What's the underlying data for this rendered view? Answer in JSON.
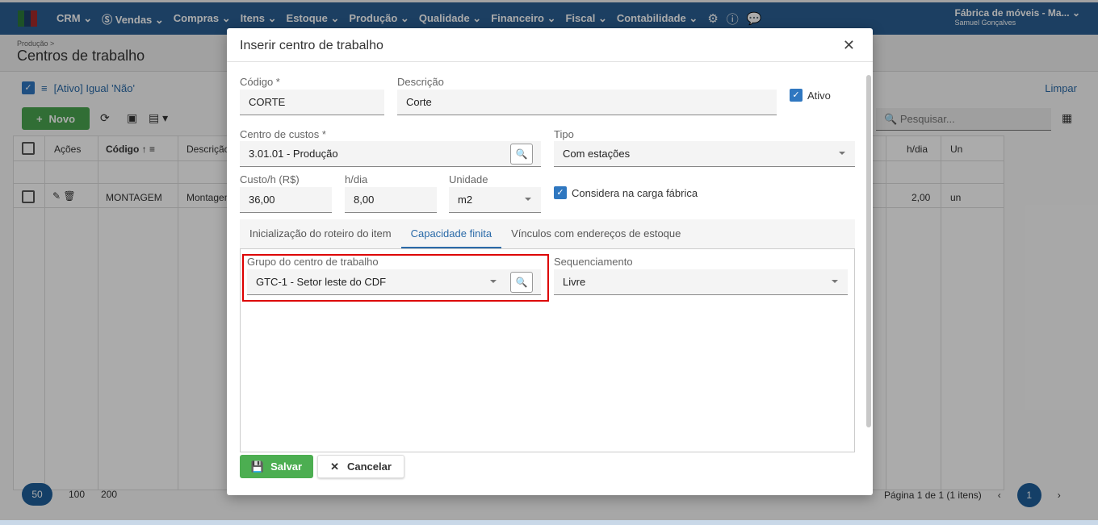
{
  "nav": {
    "items": [
      "CRM",
      "Vendas",
      "Compras",
      "Itens",
      "Estoque",
      "Produção",
      "Qualidade",
      "Financeiro",
      "Fiscal",
      "Contabilidade"
    ],
    "company": "Fábrica de móveis - Ma...",
    "user": "Samuel Gonçalves"
  },
  "page": {
    "breadcrumb": "Produção >",
    "title": "Centros de trabalho",
    "filter": "[Ativo] Igual 'Não'",
    "clear": "Limpar",
    "new_label": "Novo",
    "search_placeholder": "Pesquisar...",
    "columns": {
      "actions": "Ações",
      "code": "Código",
      "description": "Descrição",
      "hday": "h/dia",
      "unit": "Un"
    },
    "row": {
      "code": "MONTAGEM",
      "description": "Montagem",
      "hday": "2,00",
      "unit": "un"
    },
    "page_sizes": [
      "50",
      "100",
      "200"
    ],
    "page_info": "Página 1 de 1 (1 itens)",
    "current_page": "1"
  },
  "modal": {
    "title": "Inserir centro de trabalho",
    "codigo": {
      "label": "Código *",
      "value": "CORTE"
    },
    "descricao": {
      "label": "Descrição",
      "value": "Corte"
    },
    "ativo": "Ativo",
    "centro_custos": {
      "label": "Centro de custos *",
      "value": "3.01.01 - Produção"
    },
    "tipo": {
      "label": "Tipo",
      "value": "Com estações"
    },
    "custo": {
      "label": "Custo/h (R$)",
      "value": "36,00"
    },
    "hdia": {
      "label": "h/dia",
      "value": "8,00"
    },
    "unidade": {
      "label": "Unidade",
      "value": "m2"
    },
    "considera": "Considera na carga fábrica",
    "tabs": [
      "Inicialização do roteiro do item",
      "Capacidade finita",
      "Vínculos com endereços de estoque"
    ],
    "grupo": {
      "label": "Grupo do centro de trabalho",
      "value": "GTC-1 - Setor leste do CDF"
    },
    "sequenciamento": {
      "label": "Sequenciamento",
      "value": "Livre"
    },
    "save": "Salvar",
    "cancel": "Cancelar"
  }
}
